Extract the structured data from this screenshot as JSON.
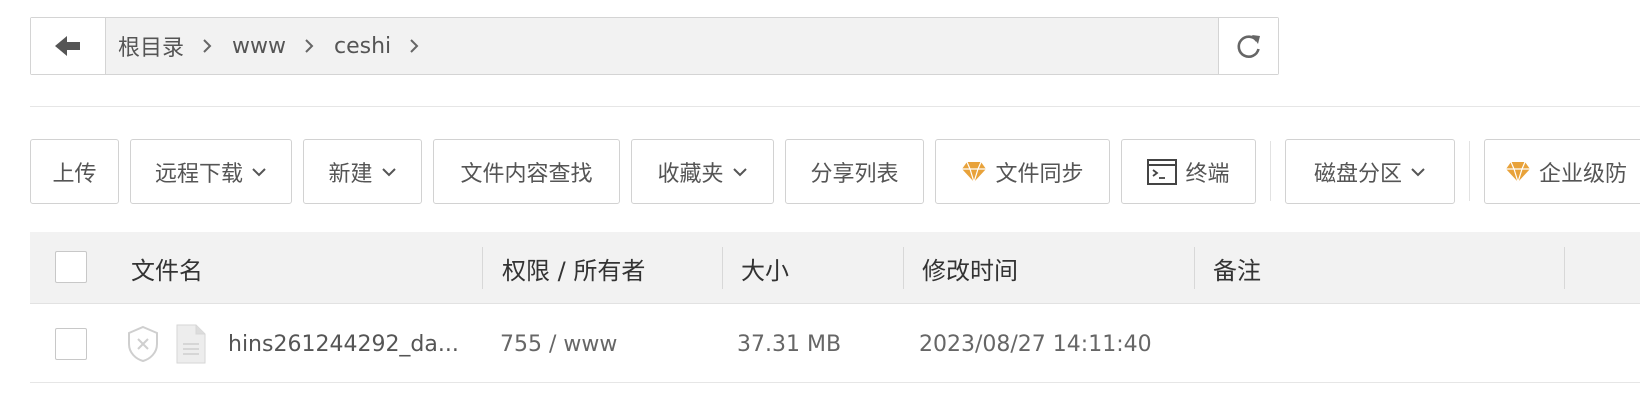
{
  "breadcrumb": {
    "items": [
      "根目录",
      "www",
      "ceshi"
    ]
  },
  "toolbar": {
    "upload": "上传",
    "remote_download": "远程下载",
    "new": "新建",
    "content_search": "文件内容查找",
    "favorites": "收藏夹",
    "share_list": "分享列表",
    "file_sync": "文件同步",
    "terminal": "终端",
    "disk_partition": "磁盘分区",
    "enterprise": "企业级防"
  },
  "table": {
    "headers": {
      "name": "文件名",
      "permission": "权限 / 所有者",
      "size": "大小",
      "modified": "修改时间",
      "note": "备注"
    },
    "rows": [
      {
        "name": "hins261244292_da...",
        "permission": "755 / www",
        "size": "37.31 MB",
        "modified": "2023/08/27 14:11:40",
        "note": ""
      }
    ]
  },
  "colors": {
    "diamond": "#e8a23a",
    "border": "#d2d2d2",
    "header_bg": "#f2f2f2"
  }
}
